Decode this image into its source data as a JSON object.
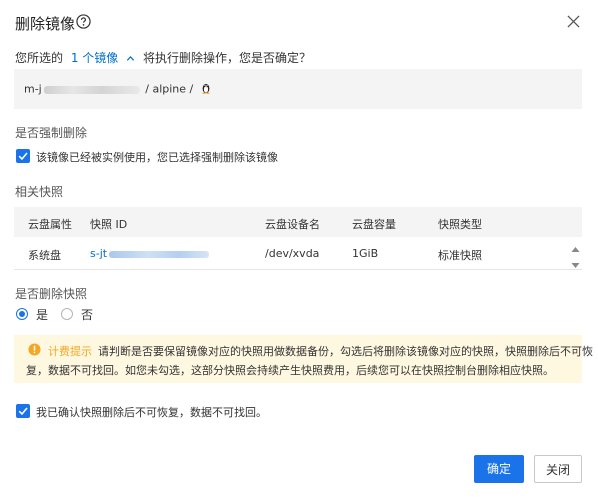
{
  "dialog": {
    "title": "删除镜像",
    "help_icon": "help-circle-icon",
    "close_icon": "close-icon"
  },
  "summary": {
    "prefix": "您所选的",
    "count_link": "1 个镜像",
    "suffix": "将执行删除操作，您是否确定？"
  },
  "image": {
    "prefix": "m-j",
    "path": "/ alpine /",
    "os_icon": "linux-penguin-icon"
  },
  "force_delete": {
    "label": "是否强制删除",
    "checkbox_text": "该镜像已经被实例使用，您已选择强制删除该镜像",
    "checked": true
  },
  "snapshots": {
    "label": "相关快照",
    "columns": [
      "云盘属性",
      "快照 ID",
      "云盘设备名",
      "云盘容量",
      "快照类型"
    ],
    "rows": [
      {
        "attr": "系统盘",
        "id_prefix": "s-jt",
        "device": "/dev/xvda",
        "size": "1GiB",
        "type": "标准快照"
      }
    ]
  },
  "delete_snapshot": {
    "label": "是否删除快照",
    "options": [
      "是",
      "否"
    ],
    "selected": "是"
  },
  "warning": {
    "title": "计费提示",
    "line1": "请判断是否要保留镜像对应的快照用做数据备份，勾选后将删除该镜像对应的快照，快照删除后不可恢",
    "line2": "复，数据不可找回。如您未勾选，这部分快照会持续产生快照费用，后续您可以在快照控制台删除相应快照。"
  },
  "confirm": {
    "text": "我已确认快照删除后不可恢复，数据不可找回。",
    "checked": true
  },
  "footer": {
    "ok_label": "确定",
    "cancel_label": "关闭"
  },
  "colors": {
    "primary": "#1a73e8",
    "link": "#0070cc",
    "warning_bg": "#fff8e1",
    "warning_icon": "#f5a623"
  }
}
